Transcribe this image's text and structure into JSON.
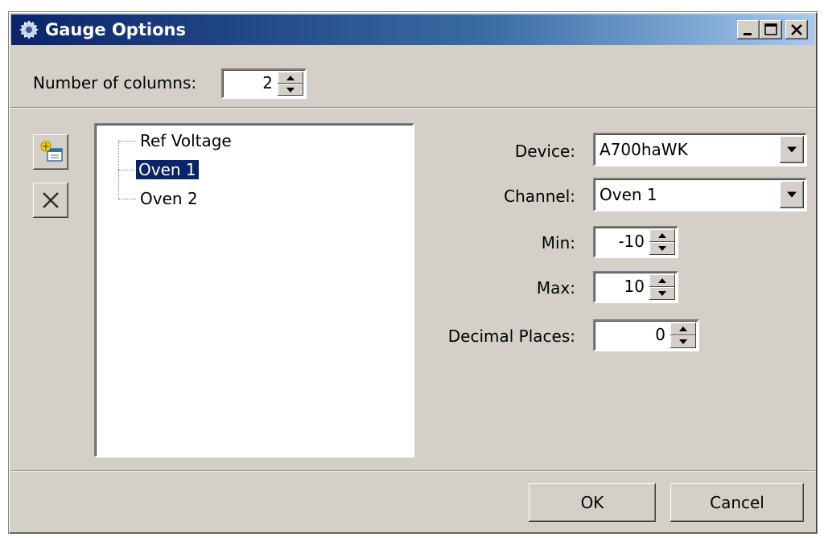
{
  "window": {
    "title": "Gauge Options",
    "icon": "gear-icon",
    "title_gradient": [
      "#0a246a",
      "#a6caf0"
    ],
    "controls": [
      "minimize-icon",
      "maximize-icon",
      "close-icon"
    ]
  },
  "columns": {
    "label": "Number of columns:",
    "value": "2"
  },
  "toolbar": {
    "add_icon": "add-gauge-icon",
    "delete_icon": "delete-icon"
  },
  "tree": {
    "items": [
      {
        "label": "Ref Voltage",
        "selected": false
      },
      {
        "label": "Oven 1",
        "selected": true
      },
      {
        "label": "Oven 2",
        "selected": false
      }
    ]
  },
  "settings": {
    "device_label": "Device:",
    "device_value": "A700haWK",
    "channel_label": "Channel:",
    "channel_value": "Oven 1",
    "min_label": "Min:",
    "min_value": "-10",
    "max_label": "Max:",
    "max_value": "10",
    "decimal_label": "Decimal Places:",
    "decimal_value": "0"
  },
  "buttons": {
    "ok": "OK",
    "cancel": "Cancel"
  },
  "colors": {
    "dialog_bg": "#d4d0c8",
    "selection": "#0a246a"
  }
}
